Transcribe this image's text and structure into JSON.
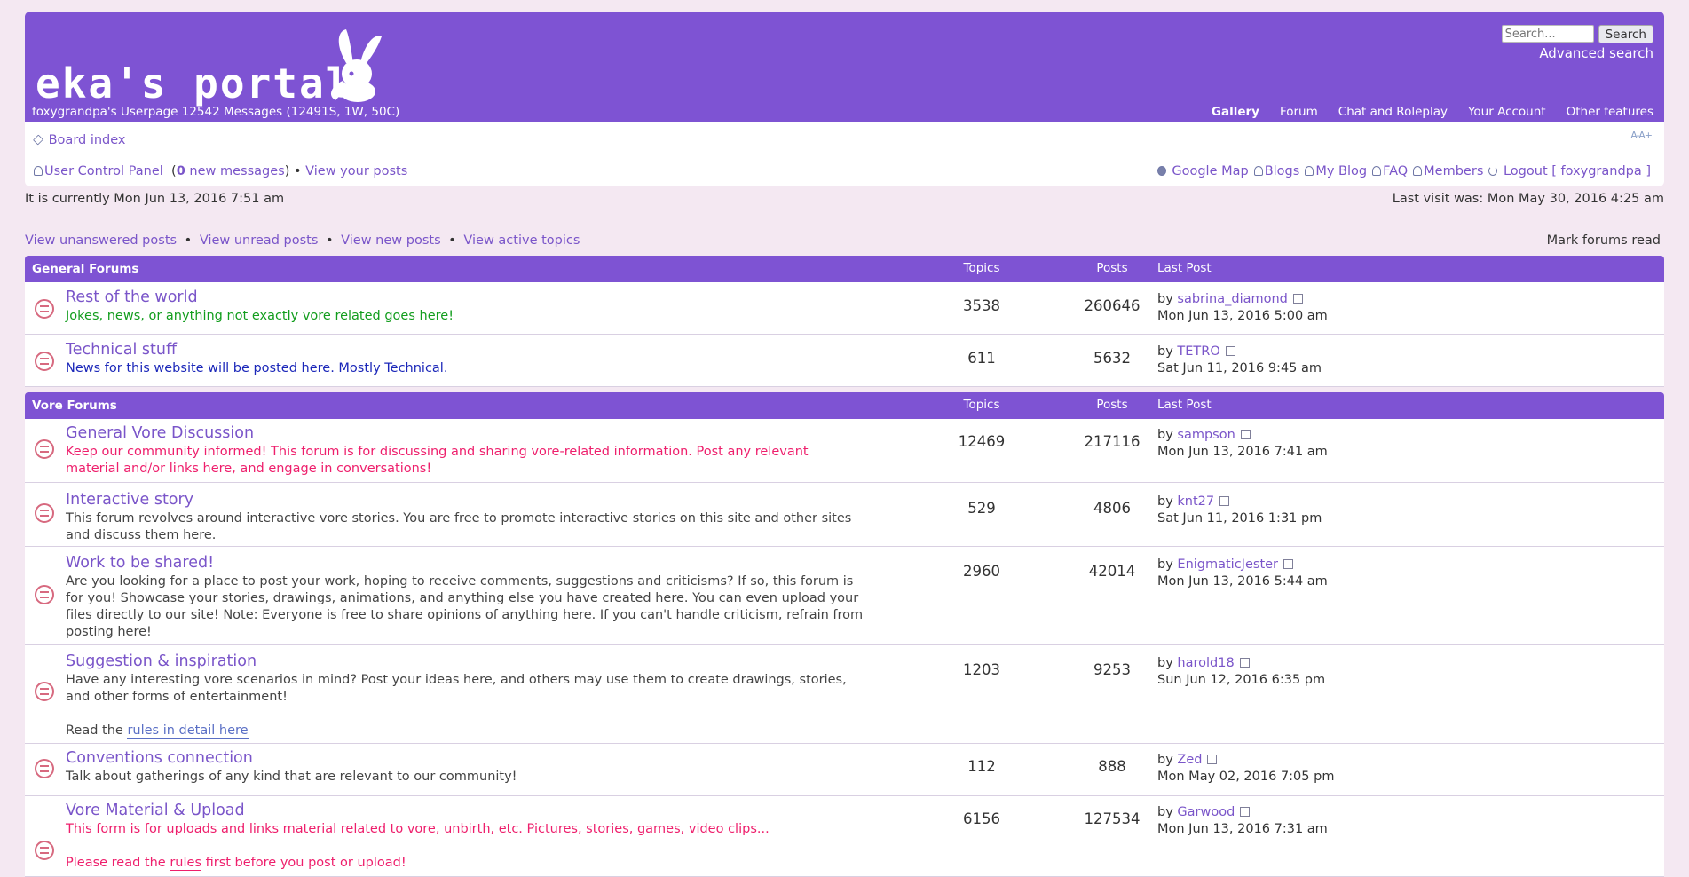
{
  "header": {
    "logo_text": "eka's portal",
    "user_line": "foxygrandpa's Userpage 12542 Messages (12491S, 1W, 50C)",
    "search_placeholder": "Search...",
    "search_button": "Search",
    "advanced_search": "Advanced search",
    "nav": [
      "Gallery",
      "Forum",
      "Chat and Roleplay",
      "Your Account",
      "Other features"
    ]
  },
  "navbar": {
    "board_index": "Board index",
    "font_size_icon": "A-A+",
    "ucp": "User Control Panel",
    "new_messages_count": "0",
    "new_messages_label": "new messages",
    "view_your_posts": "View your posts",
    "right_links": [
      "Google Map",
      "Blogs",
      "My Blog",
      "FAQ",
      "Members",
      "Logout [ foxygrandpa ]"
    ]
  },
  "status": {
    "current_time": "It is currently Mon Jun 13, 2016 7:51 am",
    "last_visit": "Last visit was: Mon May 30, 2016 4:25 am"
  },
  "quicklinks": [
    "View unanswered posts",
    "View unread posts",
    "View new posts",
    "View active topics"
  ],
  "mark_read": "Mark forums read",
  "columns": {
    "topics": "Topics",
    "posts": "Posts",
    "last_post": "Last Post"
  },
  "sections": [
    {
      "title": "General Forums",
      "forums": [
        {
          "name": "Rest of the world",
          "desc": "Jokes, news, or anything not exactly vore related goes here!",
          "topics": "3538",
          "posts": "260646",
          "by": "by",
          "user": "sabrina_diamond",
          "date": "Mon Jun 13, 2016 5:00 am"
        },
        {
          "name": "Technical stuff",
          "desc": "News for this website will be posted here. Mostly Technical.",
          "topics": "611",
          "posts": "5632",
          "by": "by",
          "user": "TETRO",
          "date": "Sat Jun 11, 2016 9:45 am"
        }
      ]
    },
    {
      "title": "Vore Forums",
      "forums": [
        {
          "name": "General Vore Discussion",
          "desc": "Keep our community informed! This forum is for discussing and sharing vore-related information. Post any relevant material and/or links here, and engage in conversations!",
          "topics": "12469",
          "posts": "217116",
          "by": "by",
          "user": "sampson",
          "date": "Mon Jun 13, 2016 7:41 am"
        },
        {
          "name": "Interactive story",
          "desc": "This forum revolves around interactive vore stories. You are free to promote interactive stories on this site and other sites and discuss them here.",
          "topics": "529",
          "posts": "4806",
          "by": "by",
          "user": "knt27",
          "date": "Sat Jun 11, 2016 1:31 pm"
        },
        {
          "name": "Work to be shared!",
          "desc": "Are you looking for a place to post your work, hoping to receive comments, suggestions and criticisms? If so, this forum is for you! Showcase your stories, drawings, animations, and anything else you have created here. You can even upload your files directly to our site! Note: Everyone is free to share opinions of anything here. If you can't handle criticism, refrain from posting here!",
          "topics": "2960",
          "posts": "42014",
          "by": "by",
          "user": "EnigmaticJester",
          "date": "Mon Jun 13, 2016 5:44 am"
        },
        {
          "name": "Suggestion & inspiration",
          "desc": "Have any interesting vore scenarios in mind? Post your ideas here, and others may use them to create drawings, stories, and other forms of entertainment!",
          "extra_prefix": "Read the",
          "extra_link": "rules in detail here",
          "topics": "1203",
          "posts": "9253",
          "by": "by",
          "user": "harold18",
          "date": "Sun Jun 12, 2016 6:35 pm"
        },
        {
          "name": "Conventions connection",
          "desc": "Talk about gatherings of any kind that are relevant to our community!",
          "topics": "112",
          "posts": "888",
          "by": "by",
          "user": "Zed",
          "date": "Mon May 02, 2016 7:05 pm"
        },
        {
          "name": "Vore Material & Upload",
          "desc": "This form is for uploads and links material related to vore, unbirth, etc. Pictures, stories, games, video clips...",
          "extra_prefix": "Please read the",
          "extra_link": "rules",
          "extra_suffix": "first before you post or upload!",
          "topics": "6156",
          "posts": "127534",
          "by": "by",
          "user": "Garwood",
          "date": "Mon Jun 13, 2016 7:31 am"
        }
      ]
    }
  ],
  "colors": {
    "header": "#7e53d3",
    "page_bg": "#f4e8f2",
    "link": "#7a55c9"
  }
}
